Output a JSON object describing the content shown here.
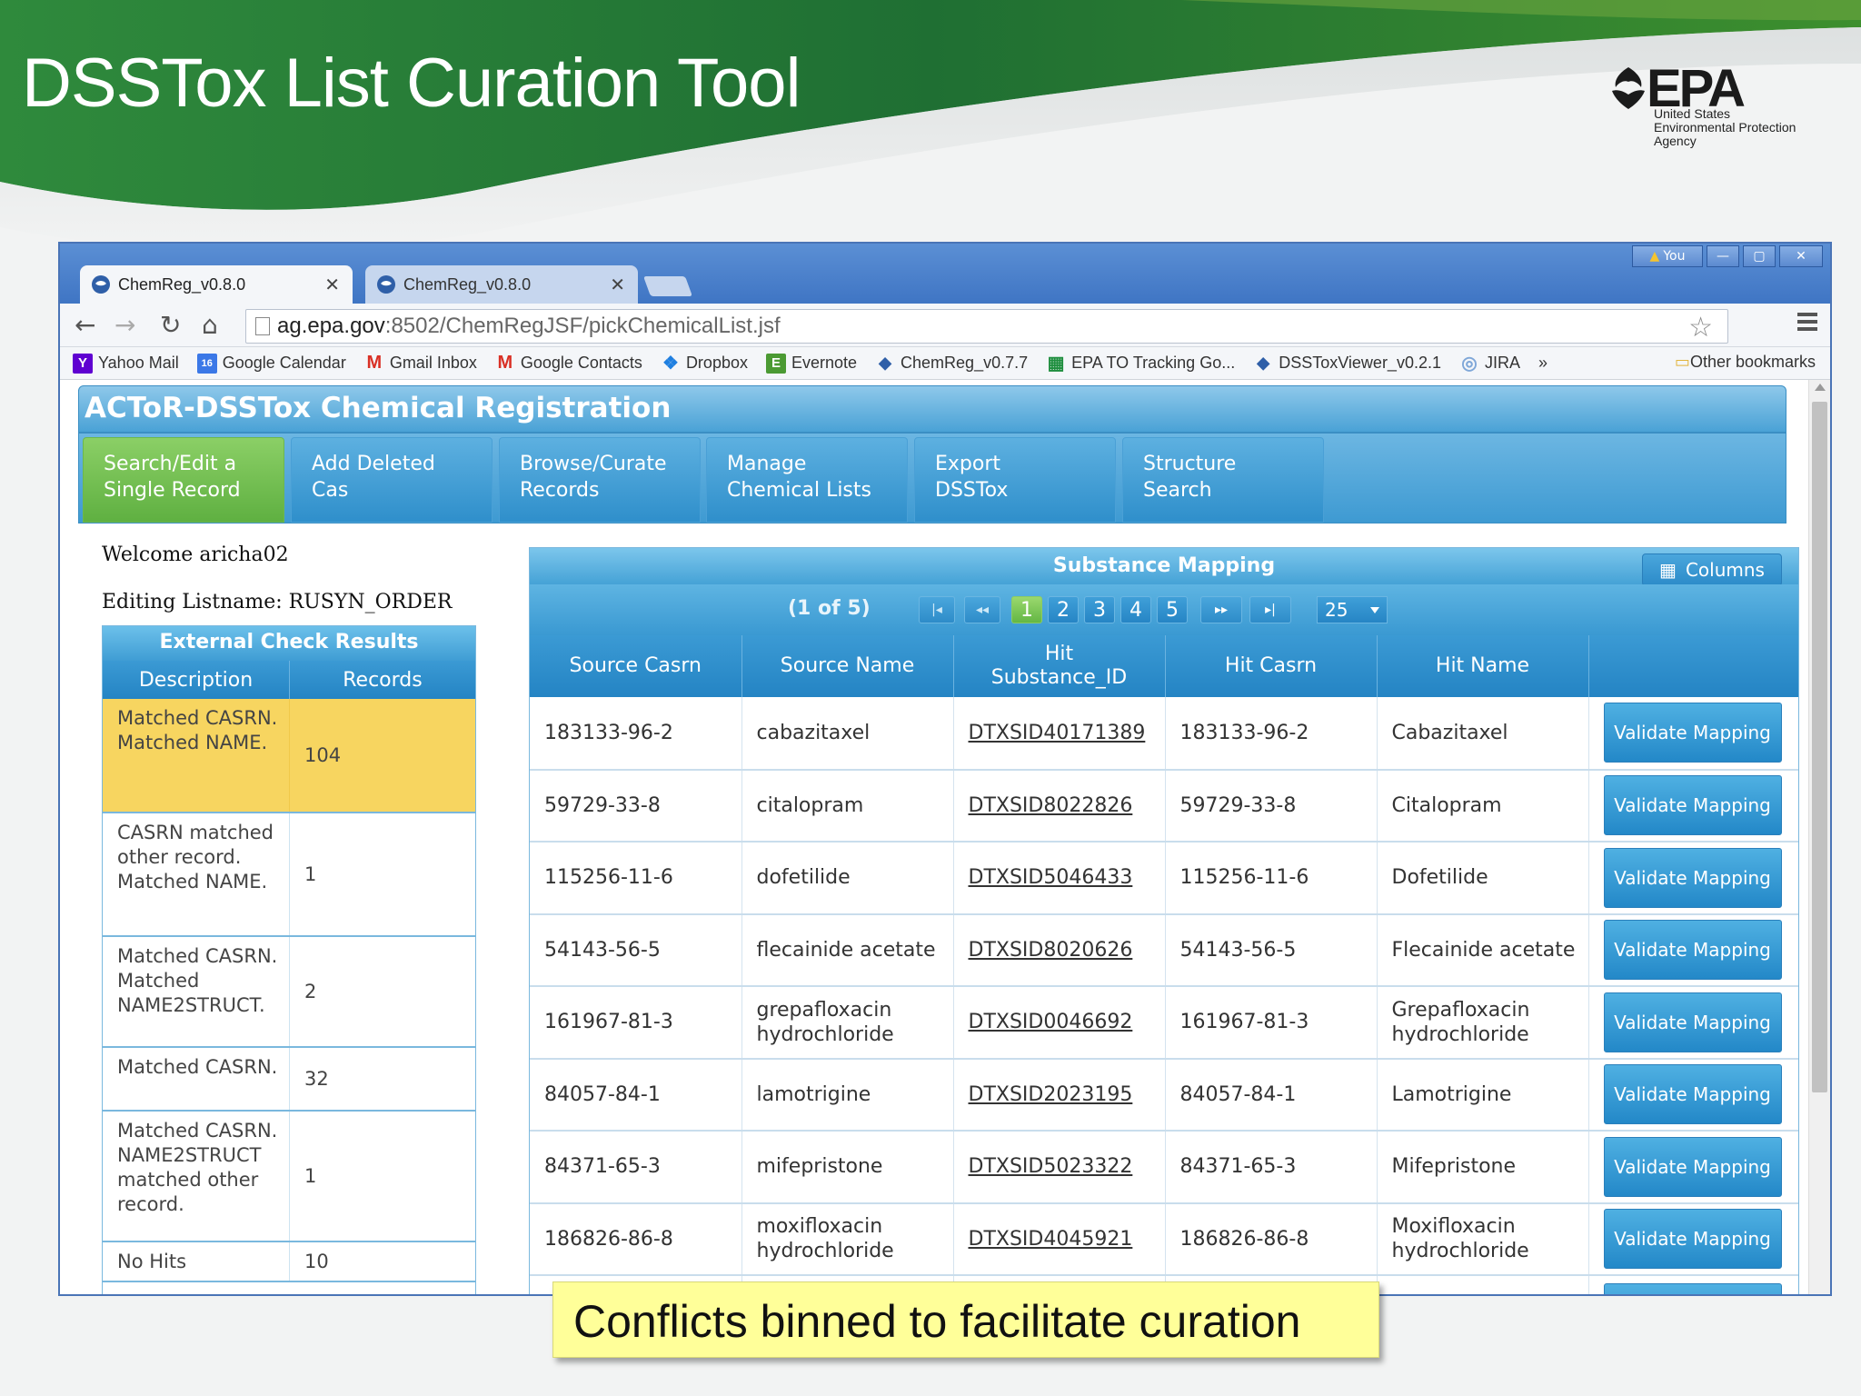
{
  "slide": {
    "title": "DSSTox List Curation Tool",
    "logo": {
      "letters": "EPA",
      "subtitle_lines": [
        "United States",
        "Environmental Protection",
        "Agency"
      ]
    }
  },
  "browser": {
    "tabs": [
      {
        "label": "ChemReg_v0.8.0",
        "active": true
      },
      {
        "label": "ChemReg_v0.8.0",
        "active": false
      }
    ],
    "window_user": "You",
    "url_host": "ag.epa.gov",
    "url_rest": ":8502/ChemRegJSF/pickChemicalList.jsf",
    "bookmarks": [
      {
        "label": "Yahoo Mail",
        "icon": "yahoo-icon",
        "color": "#5f01d1",
        "glyph": "Y"
      },
      {
        "label": "Google Calendar",
        "icon": "calendar-icon",
        "color": "#3b78e7",
        "glyph": "16"
      },
      {
        "label": "Gmail Inbox",
        "icon": "gmail-icon",
        "color": "#d93025",
        "glyph": "M"
      },
      {
        "label": "Google Contacts",
        "icon": "gmail-icon",
        "color": "#d93025",
        "glyph": "M"
      },
      {
        "label": "Dropbox",
        "icon": "dropbox-icon",
        "color": "#1f7fe0",
        "glyph": "❖"
      },
      {
        "label": "Evernote",
        "icon": "evernote-icon",
        "color": "#4b9a33",
        "glyph": "E"
      },
      {
        "label": "ChemReg_v0.7.7",
        "icon": "epa-icon",
        "color": "#2f5fa8",
        "glyph": "◆"
      },
      {
        "label": "EPA TO Tracking Go...",
        "icon": "sheet-icon",
        "color": "#1e8e3e",
        "glyph": "▦"
      },
      {
        "label": "DSSToxViewer_v0.2.1",
        "icon": "epa-icon",
        "color": "#2f5fa8",
        "glyph": "◆"
      },
      {
        "label": "JIRA",
        "icon": "jira-icon",
        "color": "#7fa7d8",
        "glyph": "◎"
      }
    ],
    "bookmarks_overflow": "»",
    "other_bookmarks": "Other bookmarks"
  },
  "app": {
    "title": "ACToR-DSSTox Chemical Registration",
    "menu": [
      {
        "line1": "Search/Edit a",
        "line2": "Single Record",
        "active": true
      },
      {
        "line1": "Add Deleted",
        "line2": "Cas",
        "active": false
      },
      {
        "line1": "Browse/Curate",
        "line2": "Records",
        "active": false
      },
      {
        "line1": "Manage",
        "line2": "Chemical Lists",
        "active": false
      },
      {
        "line1": "Export",
        "line2": "DSSTox",
        "active": false
      },
      {
        "line1": "Structure",
        "line2": "Search",
        "active": false
      }
    ],
    "welcome": "Welcome aricha02",
    "editing": "Editing Listname: RUSYN_ORDER"
  },
  "external_check": {
    "title": "External Check Results",
    "headers": [
      "Description",
      "Records"
    ],
    "rows": [
      {
        "description": "Matched CASRN. Matched NAME.",
        "records": "104",
        "highlight": true
      },
      {
        "description": "CASRN matched other record. Matched NAME.",
        "records": "1",
        "highlight": false
      },
      {
        "description": "Matched CASRN. Matched NAME2STRUCT.",
        "records": "2",
        "highlight": false
      },
      {
        "description": "Matched CASRN.",
        "records": "32",
        "highlight": false
      },
      {
        "description": "Matched CASRN. NAME2STRUCT matched other record.",
        "records": "1",
        "highlight": false
      },
      {
        "description": "No Hits",
        "records": "10",
        "highlight": false
      }
    ]
  },
  "substance_mapping": {
    "title": "Substance Mapping",
    "columns_button": "Columns",
    "pager": {
      "info": "(1 of 5)",
      "pages": [
        "1",
        "2",
        "3",
        "4",
        "5"
      ],
      "current": "1",
      "page_size": "25"
    },
    "headers": [
      "Source Casrn",
      "Source Name",
      "Hit Substance_ID",
      "Hit Casrn",
      "Hit Name",
      ""
    ],
    "validate_label": "Validate Mapping",
    "rows": [
      {
        "source_casrn": "183133-96-2",
        "source_name": "cabazitaxel",
        "hit_id": "DTXSID40171389",
        "hit_casrn": "183133-96-2",
        "hit_name": "Cabazitaxel"
      },
      {
        "source_casrn": "59729-33-8",
        "source_name": "citalopram",
        "hit_id": "DTXSID8022826",
        "hit_casrn": "59729-33-8",
        "hit_name": "Citalopram"
      },
      {
        "source_casrn": "115256-11-6",
        "source_name": "dofetilide",
        "hit_id": "DTXSID5046433",
        "hit_casrn": "115256-11-6",
        "hit_name": "Dofetilide"
      },
      {
        "source_casrn": "54143-56-5",
        "source_name": "flecainide acetate",
        "hit_id": "DTXSID8020626",
        "hit_casrn": "54143-56-5",
        "hit_name": "Flecainide acetate"
      },
      {
        "source_casrn": "161967-81-3",
        "source_name": "grepafloxacin hydrochloride",
        "hit_id": "DTXSID0046692",
        "hit_casrn": "161967-81-3",
        "hit_name": "Grepafloxacin hydrochloride"
      },
      {
        "source_casrn": "84057-84-1",
        "source_name": "lamotrigine",
        "hit_id": "DTXSID2023195",
        "hit_casrn": "84057-84-1",
        "hit_name": "Lamotrigine"
      },
      {
        "source_casrn": "84371-65-3",
        "source_name": "mifepristone",
        "hit_id": "DTXSID5023322",
        "hit_casrn": "84371-65-3",
        "hit_name": "Mifepristone"
      },
      {
        "source_casrn": "186826-86-8",
        "source_name": "moxifloxacin hydrochloride",
        "hit_id": "DTXSID4045921",
        "hit_casrn": "186826-86-8",
        "hit_name": "Moxifloxacin hydrochloride"
      }
    ]
  },
  "callout": "Conflicts binned to facilitate curation",
  "colors": {
    "slide_green": "#1f7a3a",
    "header_blue": "#3f9dd4",
    "active_tab_green": "#64b744",
    "highlight_yellow": "#f7d560",
    "callout_yellow": "#ffff99"
  }
}
